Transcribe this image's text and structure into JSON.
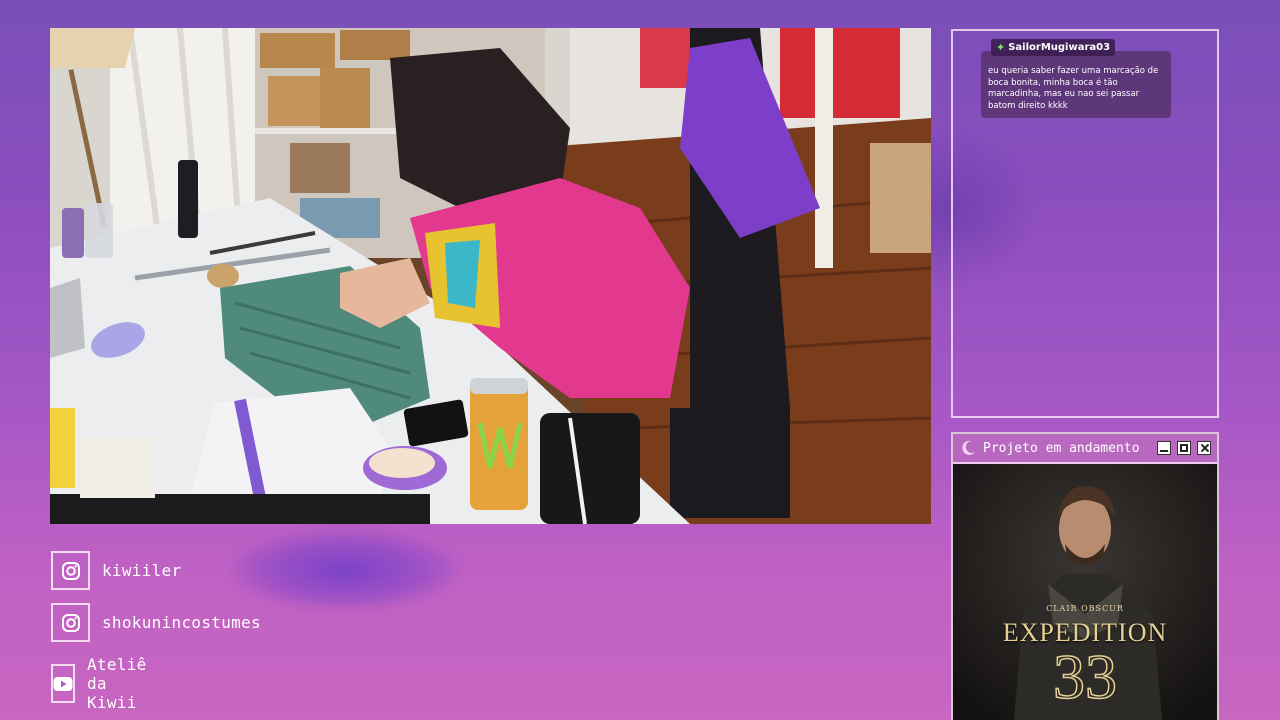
{
  "chat": {
    "username": "SailorMugiwara03",
    "badge_icon": "star-badge-icon",
    "message": "eu queria saber fazer uma marcação de boca bonita, minha boca é tão marcadinha, mas eu nao sei passar batom direito kkkk"
  },
  "project_window": {
    "title": "Projeto em andamento",
    "poster": {
      "subtitle": "CLAIR OBSCUR",
      "title": "EXPEDITION",
      "number": "33"
    }
  },
  "socials": [
    {
      "icon": "instagram-icon",
      "handle": "kiwiiler"
    },
    {
      "icon": "instagram-icon",
      "handle": "shokunincostumes"
    },
    {
      "icon": "youtube-icon",
      "handle": "Ateliê da Kiwii"
    }
  ],
  "colors": {
    "accent": "#b968c0",
    "frame": "#f0d7f0",
    "background_top": "#7a4fb8",
    "background_bottom": "#c866c0"
  }
}
